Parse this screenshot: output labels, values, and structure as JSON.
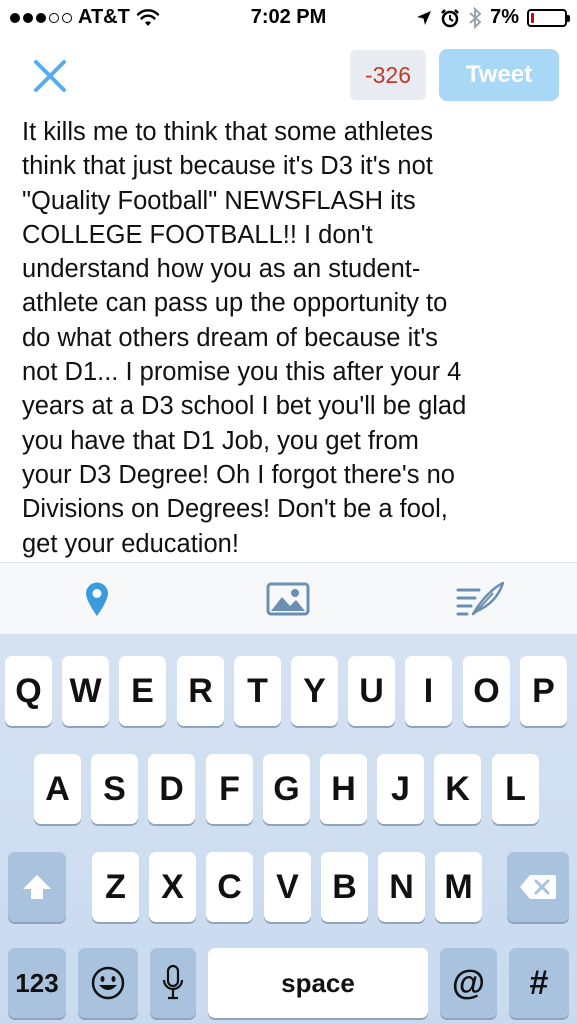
{
  "status_bar": {
    "carrier": "AT&T",
    "time": "7:02 PM",
    "battery": "7%",
    "battery_level": 0.07,
    "signal_bars_filled": 3,
    "signal_bars_total": 5
  },
  "compose": {
    "char_count": "-326",
    "tweet_label": "Tweet",
    "body_lines": [
      "It kills me to think that some athletes",
      "think that just because it's D3 it's not",
      "\"Quality Football\" NEWSFLASH its",
      "COLLEGE FOOTBALL!! I don't",
      "understand how you as an student-",
      "athlete can pass up the opportunity to",
      "do what others dream of because it's",
      "not D1... I promise you this after your 4",
      "years at a D3 school I bet you'll be glad",
      "you have that D1 Job, you get from",
      "your D3 Degree! Oh I forgot there's no",
      "Divisions on Degrees! Don't be a fool,",
      "get your education!"
    ]
  },
  "toolbar": {
    "icons": [
      "location-pin-icon",
      "image-icon",
      "drafts-quill-icon"
    ]
  },
  "keyboard": {
    "row1": [
      "Q",
      "W",
      "E",
      "R",
      "T",
      "Y",
      "U",
      "I",
      "O",
      "P"
    ],
    "row2": [
      "A",
      "S",
      "D",
      "F",
      "G",
      "H",
      "J",
      "K",
      "L"
    ],
    "row3": [
      "Z",
      "X",
      "C",
      "V",
      "B",
      "N",
      "M"
    ],
    "numbers_label": "123",
    "space_label": "space",
    "at_label": "@",
    "hash_label": "#"
  },
  "colors": {
    "accent": "#55acee",
    "tweet_disabled": "#a9d8f6",
    "negative_count": "#c0392b"
  }
}
